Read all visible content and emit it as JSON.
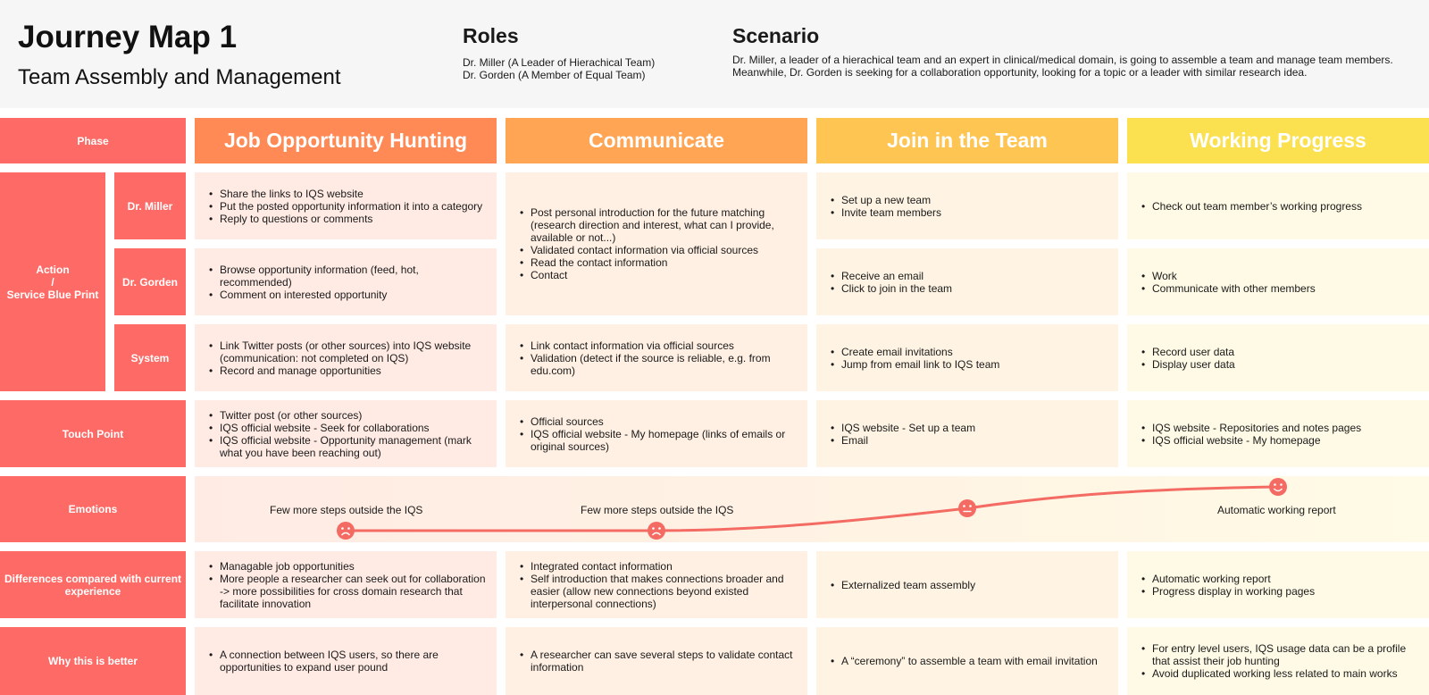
{
  "header": {
    "title": "Journey Map 1",
    "subtitle": "Team Assembly and Management",
    "roles_title": "Roles",
    "roles": [
      "Dr. Miller (A Leader of Hierachical Team)",
      "Dr. Gorden (A Member of Equal Team)"
    ],
    "scenario_title": "Scenario",
    "scenario": [
      "Dr. Miller, a leader of a hierachical team and an expert in clinical/medical domain, is going to assemble a team and manage team members.",
      "Meanwhile, Dr. Gorden is seeking for a collaboration opportunity, looking for a topic or a leader with similar research idea."
    ]
  },
  "rows": {
    "phase": "Phase",
    "action": [
      "Action",
      "/",
      "Service Blue Print"
    ],
    "miller": "Dr. Miller",
    "gorden": "Dr. Gorden",
    "system": "System",
    "touch": "Touch Point",
    "emotions": "Emotions",
    "differences": "Differences compared with current experience",
    "why": "Why this is better"
  },
  "phases": [
    {
      "name": "Job Opportunity Hunting",
      "color": "#ff8a55",
      "miller": [
        "Share the links to IQS website",
        "Put the posted opportunity information it into a category",
        "Reply to questions or comments"
      ],
      "gorden": [
        "Browse opportunity information (feed, hot, recommended)",
        "Comment on interested opportunity"
      ],
      "system": [
        "Link Twitter posts (or other sources) into IQS website (communication: not completed on IQS)",
        "Record and manage opportunities"
      ],
      "touch": [
        "Twitter post (or other sources)",
        "IQS official website - Seek for collaborations",
        "IQS official website - Opportunity management (mark what you have been reaching out)"
      ],
      "emotion_text": "Few more steps outside the IQS",
      "differences": [
        "Managable job opportunities",
        "More people a researcher can seek out for collaboration -> more possibilities for cross domain research that facilitate innovation"
      ],
      "why": [
        "A connection between IQS users, so there are opportunities to expand user pound"
      ]
    },
    {
      "name": "Communicate",
      "color": "#ffa553",
      "miller_gorden": [
        "Post personal introduction for the future matching (research direction and interest, what can I provide, available or not...)",
        "Validated contact information via official sources",
        "Read the contact information",
        "Contact"
      ],
      "system": [
        "Link contact information via official sources",
        "Validation (detect if the source is reliable, e.g. from edu.com)"
      ],
      "touch": [
        "Official sources",
        "IQS official website - My homepage (links of emails or original sources)"
      ],
      "emotion_text": "Few more steps outside the IQS",
      "differences": [
        "Integrated contact information",
        "Self introduction that makes connections broader and easier (allow new connections beyond existed interpersonal connections)"
      ],
      "why": [
        "A researcher can save several steps to validate contact information"
      ]
    },
    {
      "name": "Join in the Team",
      "color": "#ffc553",
      "miller": [
        "Set up a new team",
        "Invite team members"
      ],
      "gorden": [
        "Receive an email",
        "Click to join in the team"
      ],
      "system": [
        "Create email invitations",
        "Jump from email link to IQS team"
      ],
      "touch": [
        "IQS website - Set up a team",
        "Email"
      ],
      "emotion_text": "",
      "differences": [
        "Externalized team assembly"
      ],
      "why": [
        "A “ceremony” to assemble a team with email invitation"
      ]
    },
    {
      "name": "Working Progress",
      "color": "#fbe150",
      "miller": [
        "Check out team member’s working progress"
      ],
      "gorden": [
        "Work",
        "Communicate with other members"
      ],
      "system": [
        "Record user data",
        "Display user data"
      ],
      "touch": [
        "IQS website - Repositories and notes pages",
        "IQS official website - My homepage"
      ],
      "emotion_text": "Automatic working report",
      "differences": [
        "Automatic working report",
        "Progress display in working pages"
      ],
      "why": [
        "For entry level users, IQS usage data can be a profile that assist their job hunting",
        "Avoid duplicated working less related to main works"
      ]
    }
  ],
  "emotions": {
    "levels": [
      "sad",
      "sad",
      "neutral",
      "happy"
    ],
    "curve_color": "#f36b63"
  }
}
